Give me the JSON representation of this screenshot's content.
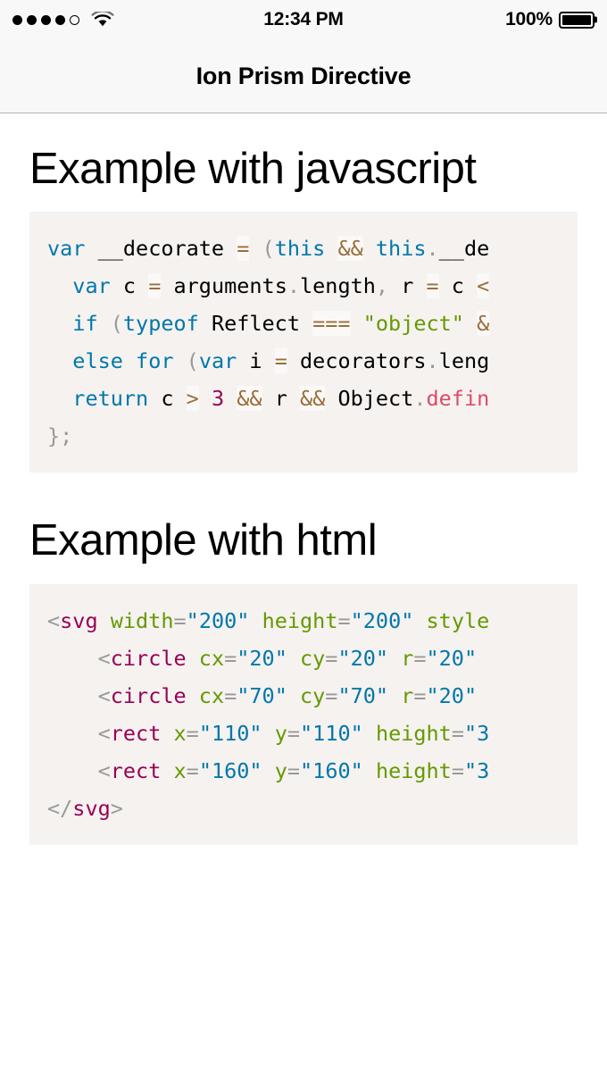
{
  "statusbar": {
    "signal_dots": {
      "filled": 4,
      "empty": 1,
      "icon": "signal-dots-icon"
    },
    "wifi_icon": "wifi-icon",
    "time": "12:34 PM",
    "battery_percent": "100%",
    "battery_icon": "battery-full-icon"
  },
  "navbar": {
    "title": "Ion Prism Directive"
  },
  "sections": [
    {
      "heading": "Example with javascript",
      "language": "javascript",
      "code_lines": [
        [
          {
            "t": "var",
            "c": "key"
          },
          {
            "t": " __decorate ",
            "c": "plain"
          },
          {
            "t": "=",
            "c": "op"
          },
          {
            "t": " ",
            "c": "plain"
          },
          {
            "t": "(",
            "c": "punc"
          },
          {
            "t": "this",
            "c": "key"
          },
          {
            "t": " ",
            "c": "plain"
          },
          {
            "t": "&&",
            "c": "op"
          },
          {
            "t": " ",
            "c": "plain"
          },
          {
            "t": "this",
            "c": "key"
          },
          {
            "t": ".",
            "c": "punc"
          },
          {
            "t": "__de",
            "c": "plain"
          }
        ],
        [
          {
            "t": "  ",
            "c": "plain"
          },
          {
            "t": "var",
            "c": "key"
          },
          {
            "t": " c ",
            "c": "plain"
          },
          {
            "t": "=",
            "c": "op"
          },
          {
            "t": " arguments",
            "c": "plain"
          },
          {
            "t": ".",
            "c": "punc"
          },
          {
            "t": "length",
            "c": "plain"
          },
          {
            "t": ",",
            "c": "punc"
          },
          {
            "t": " r ",
            "c": "plain"
          },
          {
            "t": "=",
            "c": "op"
          },
          {
            "t": " c ",
            "c": "plain"
          },
          {
            "t": "<",
            "c": "op"
          }
        ],
        [
          {
            "t": "  ",
            "c": "plain"
          },
          {
            "t": "if",
            "c": "key"
          },
          {
            "t": " ",
            "c": "plain"
          },
          {
            "t": "(",
            "c": "punc"
          },
          {
            "t": "typeof",
            "c": "key"
          },
          {
            "t": " Reflect ",
            "c": "plain"
          },
          {
            "t": "===",
            "c": "op"
          },
          {
            "t": " ",
            "c": "plain"
          },
          {
            "t": "\"object\"",
            "c": "str"
          },
          {
            "t": " ",
            "c": "plain"
          },
          {
            "t": "&",
            "c": "op"
          }
        ],
        [
          {
            "t": "  ",
            "c": "plain"
          },
          {
            "t": "else",
            "c": "key"
          },
          {
            "t": " ",
            "c": "plain"
          },
          {
            "t": "for",
            "c": "key"
          },
          {
            "t": " ",
            "c": "plain"
          },
          {
            "t": "(",
            "c": "punc"
          },
          {
            "t": "var",
            "c": "key"
          },
          {
            "t": " i ",
            "c": "plain"
          },
          {
            "t": "=",
            "c": "op"
          },
          {
            "t": " decorators",
            "c": "plain"
          },
          {
            "t": ".",
            "c": "punc"
          },
          {
            "t": "leng",
            "c": "plain"
          }
        ],
        [
          {
            "t": "  ",
            "c": "plain"
          },
          {
            "t": "return",
            "c": "key"
          },
          {
            "t": " c ",
            "c": "plain"
          },
          {
            "t": ">",
            "c": "op"
          },
          {
            "t": " ",
            "c": "plain"
          },
          {
            "t": "3",
            "c": "num"
          },
          {
            "t": " ",
            "c": "plain"
          },
          {
            "t": "&&",
            "c": "op"
          },
          {
            "t": " r ",
            "c": "plain"
          },
          {
            "t": "&&",
            "c": "op"
          },
          {
            "t": " Object",
            "c": "plain"
          },
          {
            "t": ".",
            "c": "punc"
          },
          {
            "t": "defin",
            "c": "fn"
          }
        ],
        [
          {
            "t": "}",
            "c": "punc"
          },
          {
            "t": ";",
            "c": "punc"
          }
        ]
      ]
    },
    {
      "heading": "Example with html",
      "language": "html",
      "code_lines": [
        [
          {
            "t": "<",
            "c": "punc"
          },
          {
            "t": "svg",
            "c": "tag"
          },
          {
            "t": " ",
            "c": "plain"
          },
          {
            "t": "width",
            "c": "attr"
          },
          {
            "t": "=",
            "c": "punc"
          },
          {
            "t": "\"200\"",
            "c": "val"
          },
          {
            "t": " ",
            "c": "plain"
          },
          {
            "t": "height",
            "c": "attr"
          },
          {
            "t": "=",
            "c": "punc"
          },
          {
            "t": "\"200\"",
            "c": "val"
          },
          {
            "t": " ",
            "c": "plain"
          },
          {
            "t": "style",
            "c": "attr"
          }
        ],
        [
          {
            "t": "    ",
            "c": "plain"
          },
          {
            "t": "<",
            "c": "punc"
          },
          {
            "t": "circle",
            "c": "tag"
          },
          {
            "t": " ",
            "c": "plain"
          },
          {
            "t": "cx",
            "c": "attr"
          },
          {
            "t": "=",
            "c": "punc"
          },
          {
            "t": "\"20\"",
            "c": "val"
          },
          {
            "t": " ",
            "c": "plain"
          },
          {
            "t": "cy",
            "c": "attr"
          },
          {
            "t": "=",
            "c": "punc"
          },
          {
            "t": "\"20\"",
            "c": "val"
          },
          {
            "t": " ",
            "c": "plain"
          },
          {
            "t": "r",
            "c": "attr"
          },
          {
            "t": "=",
            "c": "punc"
          },
          {
            "t": "\"20\"",
            "c": "val"
          }
        ],
        [
          {
            "t": "    ",
            "c": "plain"
          },
          {
            "t": "<",
            "c": "punc"
          },
          {
            "t": "circle",
            "c": "tag"
          },
          {
            "t": " ",
            "c": "plain"
          },
          {
            "t": "cx",
            "c": "attr"
          },
          {
            "t": "=",
            "c": "punc"
          },
          {
            "t": "\"70\"",
            "c": "val"
          },
          {
            "t": " ",
            "c": "plain"
          },
          {
            "t": "cy",
            "c": "attr"
          },
          {
            "t": "=",
            "c": "punc"
          },
          {
            "t": "\"70\"",
            "c": "val"
          },
          {
            "t": " ",
            "c": "plain"
          },
          {
            "t": "r",
            "c": "attr"
          },
          {
            "t": "=",
            "c": "punc"
          },
          {
            "t": "\"20\"",
            "c": "val"
          }
        ],
        [
          {
            "t": "    ",
            "c": "plain"
          },
          {
            "t": "<",
            "c": "punc"
          },
          {
            "t": "rect",
            "c": "tag"
          },
          {
            "t": " ",
            "c": "plain"
          },
          {
            "t": "x",
            "c": "attr"
          },
          {
            "t": "=",
            "c": "punc"
          },
          {
            "t": "\"110\"",
            "c": "val"
          },
          {
            "t": " ",
            "c": "plain"
          },
          {
            "t": "y",
            "c": "attr"
          },
          {
            "t": "=",
            "c": "punc"
          },
          {
            "t": "\"110\"",
            "c": "val"
          },
          {
            "t": " ",
            "c": "plain"
          },
          {
            "t": "height",
            "c": "attr"
          },
          {
            "t": "=",
            "c": "punc"
          },
          {
            "t": "\"3",
            "c": "val"
          }
        ],
        [
          {
            "t": "    ",
            "c": "plain"
          },
          {
            "t": "<",
            "c": "punc"
          },
          {
            "t": "rect",
            "c": "tag"
          },
          {
            "t": " ",
            "c": "plain"
          },
          {
            "t": "x",
            "c": "attr"
          },
          {
            "t": "=",
            "c": "punc"
          },
          {
            "t": "\"160\"",
            "c": "val"
          },
          {
            "t": " ",
            "c": "plain"
          },
          {
            "t": "y",
            "c": "attr"
          },
          {
            "t": "=",
            "c": "punc"
          },
          {
            "t": "\"160\"",
            "c": "val"
          },
          {
            "t": " ",
            "c": "plain"
          },
          {
            "t": "height",
            "c": "attr"
          },
          {
            "t": "=",
            "c": "punc"
          },
          {
            "t": "\"3",
            "c": "val"
          }
        ],
        [
          {
            "t": "</",
            "c": "punc"
          },
          {
            "t": "svg",
            "c": "tag"
          },
          {
            "t": ">",
            "c": "punc"
          }
        ]
      ]
    }
  ],
  "colors": {
    "page_bg": "#ffffff",
    "bar_bg": "#f8f8f8",
    "bar_border": "#b2b2b2",
    "code_bg": "#f5f2f0",
    "keyword": "#0077aa",
    "string": "#669900",
    "number": "#990055",
    "function": "#DD4A68",
    "punctuation": "#999999",
    "operator": "#9a6e3a",
    "tag": "#990055",
    "attr_name": "#669900",
    "attr_value": "#0077aa"
  }
}
